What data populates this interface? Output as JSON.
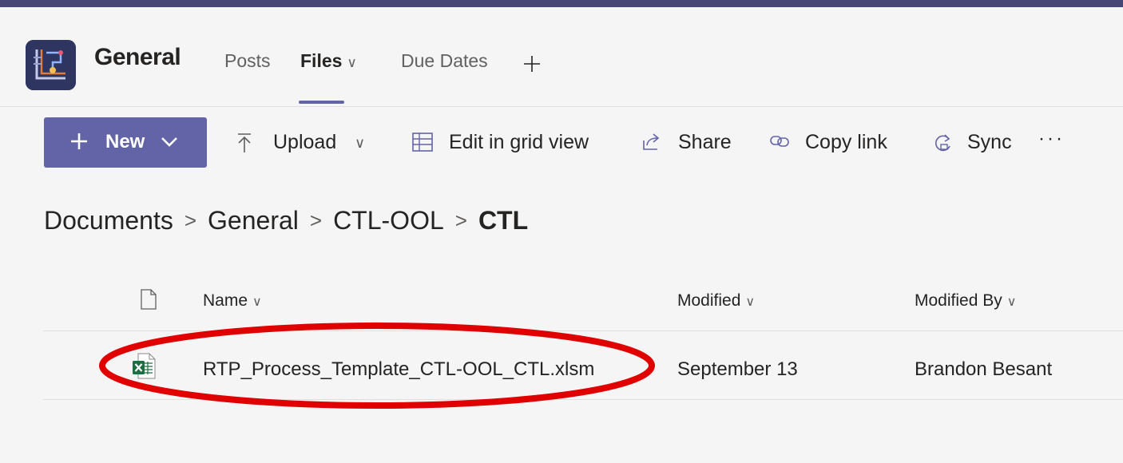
{
  "header": {
    "app_icon": "teams-app-icon",
    "channel_title": "General",
    "tabs": [
      {
        "label": "Posts"
      },
      {
        "label": "Files",
        "active": true
      },
      {
        "label": "Due Dates"
      }
    ],
    "tab_dropdown_glyph": "∨",
    "add_tab_icon": "plus-icon"
  },
  "toolbar": {
    "new_label": "New",
    "upload_label": "Upload",
    "upload_chevron": "∨",
    "grid_label": "Edit in grid view",
    "share_label": "Share",
    "copy_link_label": "Copy link",
    "sync_label": "Sync",
    "more_label": "···"
  },
  "breadcrumb": {
    "items": [
      "Documents",
      "General",
      "CTL-OOL",
      "CTL"
    ],
    "separator": ">"
  },
  "list": {
    "columns": [
      {
        "label": "Name",
        "sort": "∨"
      },
      {
        "label": "Modified",
        "sort": "∨"
      },
      {
        "label": "Modified By",
        "sort": "∨"
      }
    ],
    "rows": [
      {
        "name": "RTP_Process_Template_CTL-OOL_CTL.xlsm",
        "modified": "September 13",
        "modified_by": "Brandon Besant",
        "icon": "excel-file-icon"
      }
    ]
  },
  "annotation": {
    "highlight_color": "#e00000"
  },
  "colors": {
    "accent": "#6264a7",
    "top_strip": "#464775",
    "background": "#f5f5f5",
    "excel_green": "#1d6f42"
  }
}
